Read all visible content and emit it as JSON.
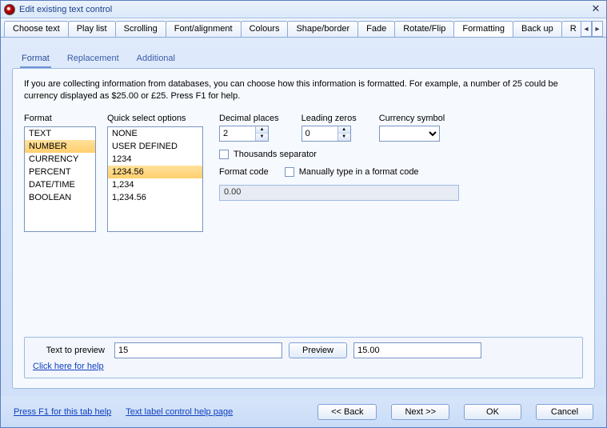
{
  "window": {
    "title": "Edit existing text control"
  },
  "mainTabs": {
    "items": [
      {
        "label": "Choose text"
      },
      {
        "label": "Play list"
      },
      {
        "label": "Scrolling"
      },
      {
        "label": "Font/alignment"
      },
      {
        "label": "Colours"
      },
      {
        "label": "Shape/border"
      },
      {
        "label": "Fade"
      },
      {
        "label": "Rotate/Flip"
      },
      {
        "label": "Formatting"
      },
      {
        "label": "Back up"
      },
      {
        "label": "R"
      }
    ],
    "activeIndex": 8
  },
  "subTabs": {
    "items": [
      {
        "label": "Format"
      },
      {
        "label": "Replacement"
      },
      {
        "label": "Additional"
      }
    ],
    "activeIndex": 0
  },
  "panel": {
    "description": "If you are collecting information from databases, you can choose how this information is formatted.  For example, a number of 25 could be currency displayed as $25.00 or £25.  Press F1 for help.",
    "formatList": {
      "label": "Format",
      "items": [
        "TEXT",
        "NUMBER",
        "CURRENCY",
        "PERCENT",
        "DATE/TIME",
        "BOOLEAN"
      ],
      "selectedIndex": 1
    },
    "quickSelect": {
      "label": "Quick select options",
      "items": [
        "NONE",
        "USER DEFINED",
        "1234",
        "1234.56",
        "1,234",
        "1,234.56"
      ],
      "selectedIndex": 3
    },
    "decimalPlaces": {
      "label": "Decimal places",
      "value": "2"
    },
    "leadingZeros": {
      "label": "Leading zeros",
      "value": "0"
    },
    "currencySymbol": {
      "label": "Currency symbol",
      "value": ""
    },
    "thousandsSeparator": {
      "label": "Thousands separator",
      "checked": false
    },
    "formatCode": {
      "label": "Format code",
      "value": "0.00"
    },
    "manualCode": {
      "label": "Manually type in a format code",
      "checked": false
    },
    "preview": {
      "label": "Text to preview",
      "input": "15",
      "buttonLabel": "Preview",
      "output": "15.00",
      "helpLink": "Click here for help"
    }
  },
  "footer": {
    "help1": "Press F1 for this tab help",
    "help2": "Text label control help page",
    "back": "<< Back",
    "next": "Next >>",
    "ok": "OK",
    "cancel": "Cancel"
  }
}
